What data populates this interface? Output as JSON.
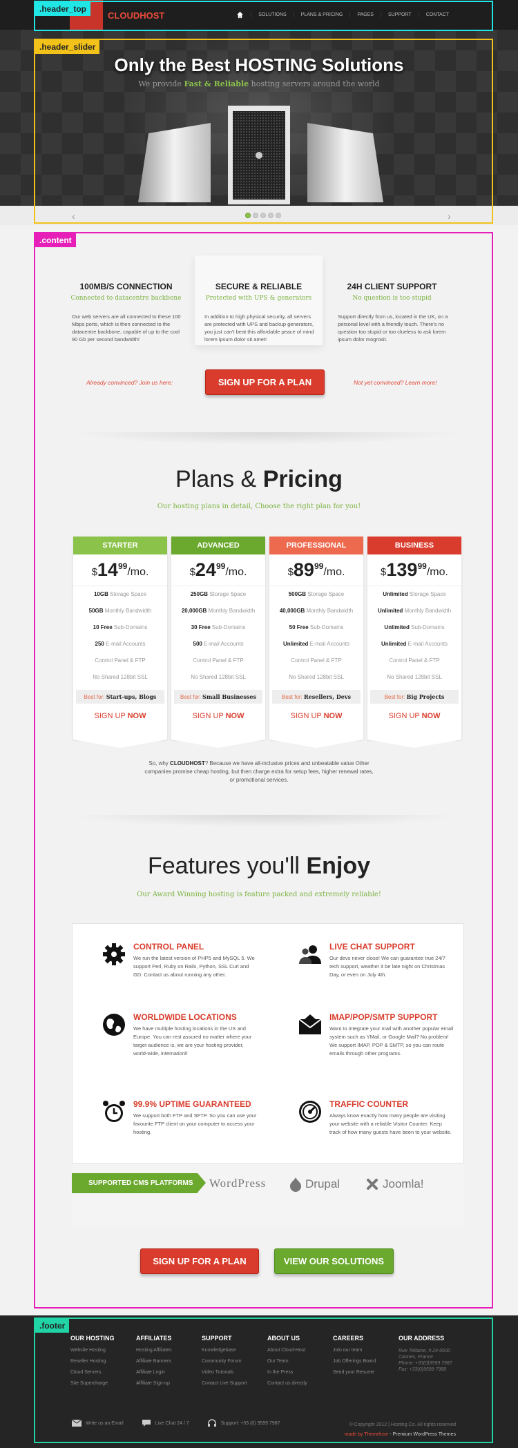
{
  "annotations": {
    "header_top": ".header_top",
    "header_slider": ".header_slider",
    "content": ".content",
    "footer": ".footer"
  },
  "header": {
    "logo": "CLOUDHOST",
    "nav": [
      "SOLUTIONS",
      "PLANS & PRICING",
      "PAGES",
      "SUPPORT",
      "CONTACT"
    ],
    "home_icon": "home-icon"
  },
  "slider": {
    "title": "Only the Best HOSTING Solutions",
    "subtitle_pre": "We provide",
    "subtitle_highlight": "Fast & Reliable",
    "subtitle_post": "hosting servers around the world",
    "active_slide": 1,
    "slide_count": 5
  },
  "intro": [
    {
      "title": "100MB/S CONNECTION",
      "subtitle": "Connected to datacentre backbone",
      "text": "Our web servers are all connected to these 100 Mbps ports, which is then connected to the datacentre backbone, capable of up to the cool 90 Gb per second bandwidth!"
    },
    {
      "title": "SECURE & RELIABLE",
      "subtitle": "Protected with UPS & generators",
      "text": "In addition to high physical security, all servers are protected with UPS and backup generators, you just can't beat this affordable peace of mind lorem ipsum dolor sit amet!"
    },
    {
      "title": "24H CLIENT SUPPORT",
      "subtitle": "No question is too stupid",
      "text": "Support directly from us, located in the UK, on a personal level with a friendly touch. There's no question too stupid or too clueless to ask lorem ipsum dolor mogrosit."
    }
  ],
  "cta": {
    "left": "Already convinced? Join us here:",
    "button": "SIGN UP FOR A PLAN",
    "right": "Not yet convinced? Learn more!"
  },
  "plans_section": {
    "title_light": "Plans &",
    "title_bold": "Pricing",
    "subtitle": "Our hosting plans in detail, Choose the right plan for you!"
  },
  "plans": [
    {
      "name": "STARTER",
      "color": "#8bc34a",
      "currency": "$",
      "amount": "14",
      "cents": "99",
      "per": "/mo.",
      "rows": [
        [
          "10GB",
          "Storage Space"
        ],
        [
          "50GB",
          "Monthly Bandwidth"
        ],
        [
          "10 Free",
          "Sub-Domains"
        ],
        [
          "250",
          "E-mail Accounts"
        ],
        [
          "",
          "Control Panel & FTP"
        ],
        [
          "",
          "No Shared 128bit SSL"
        ]
      ],
      "best_label": "Best for:",
      "best_value": "Start-ups, Blogs",
      "signup": "SIGN UP",
      "signup_bold": "NOW"
    },
    {
      "name": "ADVANCED",
      "color": "#6aa82e",
      "currency": "$",
      "amount": "24",
      "cents": "99",
      "per": "/mo.",
      "rows": [
        [
          "250GB",
          "Storage Space"
        ],
        [
          "20,000GB",
          "Monthly Bandwidth"
        ],
        [
          "30 Free",
          "Sub-Domains"
        ],
        [
          "500",
          "E-mail Accounts"
        ],
        [
          "",
          "Control Panel & FTP"
        ],
        [
          "",
          "No Shared 128bit SSL"
        ]
      ],
      "best_label": "Best for:",
      "best_value": "Small Businesses",
      "signup": "SIGN UP",
      "signup_bold": "NOW"
    },
    {
      "name": "PROFESSIONAL",
      "color": "#ee6a4f",
      "currency": "$",
      "amount": "89",
      "cents": "99",
      "per": "/mo.",
      "rows": [
        [
          "500GB",
          "Storage Space"
        ],
        [
          "40,000GB",
          "Monthly Bandwidth"
        ],
        [
          "50 Free",
          "Sub-Domains"
        ],
        [
          "Unlimited",
          "E-mail Accounts"
        ],
        [
          "",
          "Control Panel & FTP"
        ],
        [
          "",
          "No Shared 128bit SSL"
        ]
      ],
      "best_label": "Best for:",
      "best_value": "Resellers, Devs",
      "signup": "SIGN UP",
      "signup_bold": "NOW"
    },
    {
      "name": "BUSINESS",
      "color": "#d93c2c",
      "currency": "$",
      "amount": "139",
      "cents": "99",
      "per": "/mo.",
      "rows": [
        [
          "Unlimited",
          "Storage Space"
        ],
        [
          "Unlimited",
          "Monthly Bandwidth"
        ],
        [
          "Unlimited",
          "Sub-Domains"
        ],
        [
          "Unlimited",
          "E-mail Accounts"
        ],
        [
          "",
          "Control Panel & FTP"
        ],
        [
          "",
          "No Shared 128bit SSL"
        ]
      ],
      "best_label": "Best for:",
      "best_value": "Big Projects",
      "signup": "SIGN UP",
      "signup_bold": "NOW"
    }
  ],
  "why": {
    "pre": "So, why",
    "brand": "CLOUDHOST",
    "post": "? Because we have all-inclusive prices and unbeatable value Other companies promise cheap hosting, but then charge extra for setup fees, higher renewal rates, or promotional services."
  },
  "features_section": {
    "title_light": "Features you'll",
    "title_bold": "Enjoy",
    "subtitle": "Our Award Winning hosting is feature packed and extremely reliable!"
  },
  "features": [
    {
      "title": "CONTROL PANEL",
      "icon": "gear-icon",
      "text": "We run the latest version of PHP5 and MySQL 5. We support Perl, Ruby on Rails, Python, SSL Curl and GD. Contact us about running any other."
    },
    {
      "title": "LIVE CHAT SUPPORT",
      "icon": "users-icon",
      "text": "Our devs never close! We can guarantee true 24/7 tech support, weather it be late night on Christmas Day, or even on July 4th."
    },
    {
      "title": "WORLDWIDE LOCATIONS",
      "icon": "globe-icon",
      "text": "We have multiple hosting locations in the US and Europe. You can rest assured no matter where your target audience is, we are your hosting provider, world-wide, internationl!"
    },
    {
      "title": "IMAP/POP/SMTP SUPPORT",
      "icon": "envelope-icon",
      "text": "Want to integrate your mail with another popular email system such as YMail, or Google Mail? No problem! We support IMAP, POP & SMTP, so you can route emails through other programs."
    },
    {
      "title": "99.9% UPTIME GUARANTEED",
      "icon": "alarm-clock-icon",
      "text": "We support both FTP and SFTP. So you can use your favourite FTP client on your computer to access your hosting."
    },
    {
      "title": "TRAFFIC COUNTER",
      "icon": "gauge-icon",
      "text": "Always know exactly how many people are visiting your website with a reliable Visitor Counter. Keep track of how many guests have been to your website."
    }
  ],
  "cms": {
    "label": "SUPPORTED CMS PLATFORMS",
    "logos": [
      "WordPress",
      "Drupal",
      "Joomla!"
    ]
  },
  "bottom_buttons": {
    "signup": "SIGN UP FOR A PLAN",
    "solutions": "VIEW OUR SOLUTIONS"
  },
  "footer": {
    "columns": [
      {
        "title": "OUR HOSTING",
        "items": [
          "Website Hosting",
          "Reseller Hosting",
          "Cloud Servers",
          "Site Supercharge"
        ]
      },
      {
        "title": "AFFILIATES",
        "items": [
          "Hosting Affiliates",
          "Affiliate Banners",
          "Affiliate Login",
          "Affiliate Sign-up"
        ]
      },
      {
        "title": "SUPPORT",
        "items": [
          "Knowledgebase",
          "Community Forum",
          "Video Tutorials",
          "Contact Live Support"
        ]
      },
      {
        "title": "ABOUT US",
        "items": [
          "About Cloud-Host",
          "Our Team",
          "In the Press",
          "Contact us directly"
        ]
      },
      {
        "title": "CAREERS",
        "items": [
          "Join our team",
          "Job Offerings Board",
          "Send your Resume"
        ]
      },
      {
        "title": "OUR ADDRESS",
        "items": [
          "Rue Tettaine, #.24-0600",
          "Cannes, France",
          "Phone: +33(0)9599 7987",
          "Fax: +33(0)9599 7988"
        ]
      }
    ],
    "contact": [
      {
        "icon": "mail-icon",
        "label": "Write us an Email"
      },
      {
        "icon": "chat-icon",
        "label": "Live Chat 24 / 7"
      },
      {
        "icon": "headset-icon",
        "label": "Support: +33 (0) 9599 7987"
      }
    ],
    "copyright": "© Copyright 2012 | Hosting Co. All rights reserved",
    "made_by_pre": "made by",
    "made_by_brand": "Themefuse",
    "made_by_post": "- Premium WordPress Themes"
  }
}
